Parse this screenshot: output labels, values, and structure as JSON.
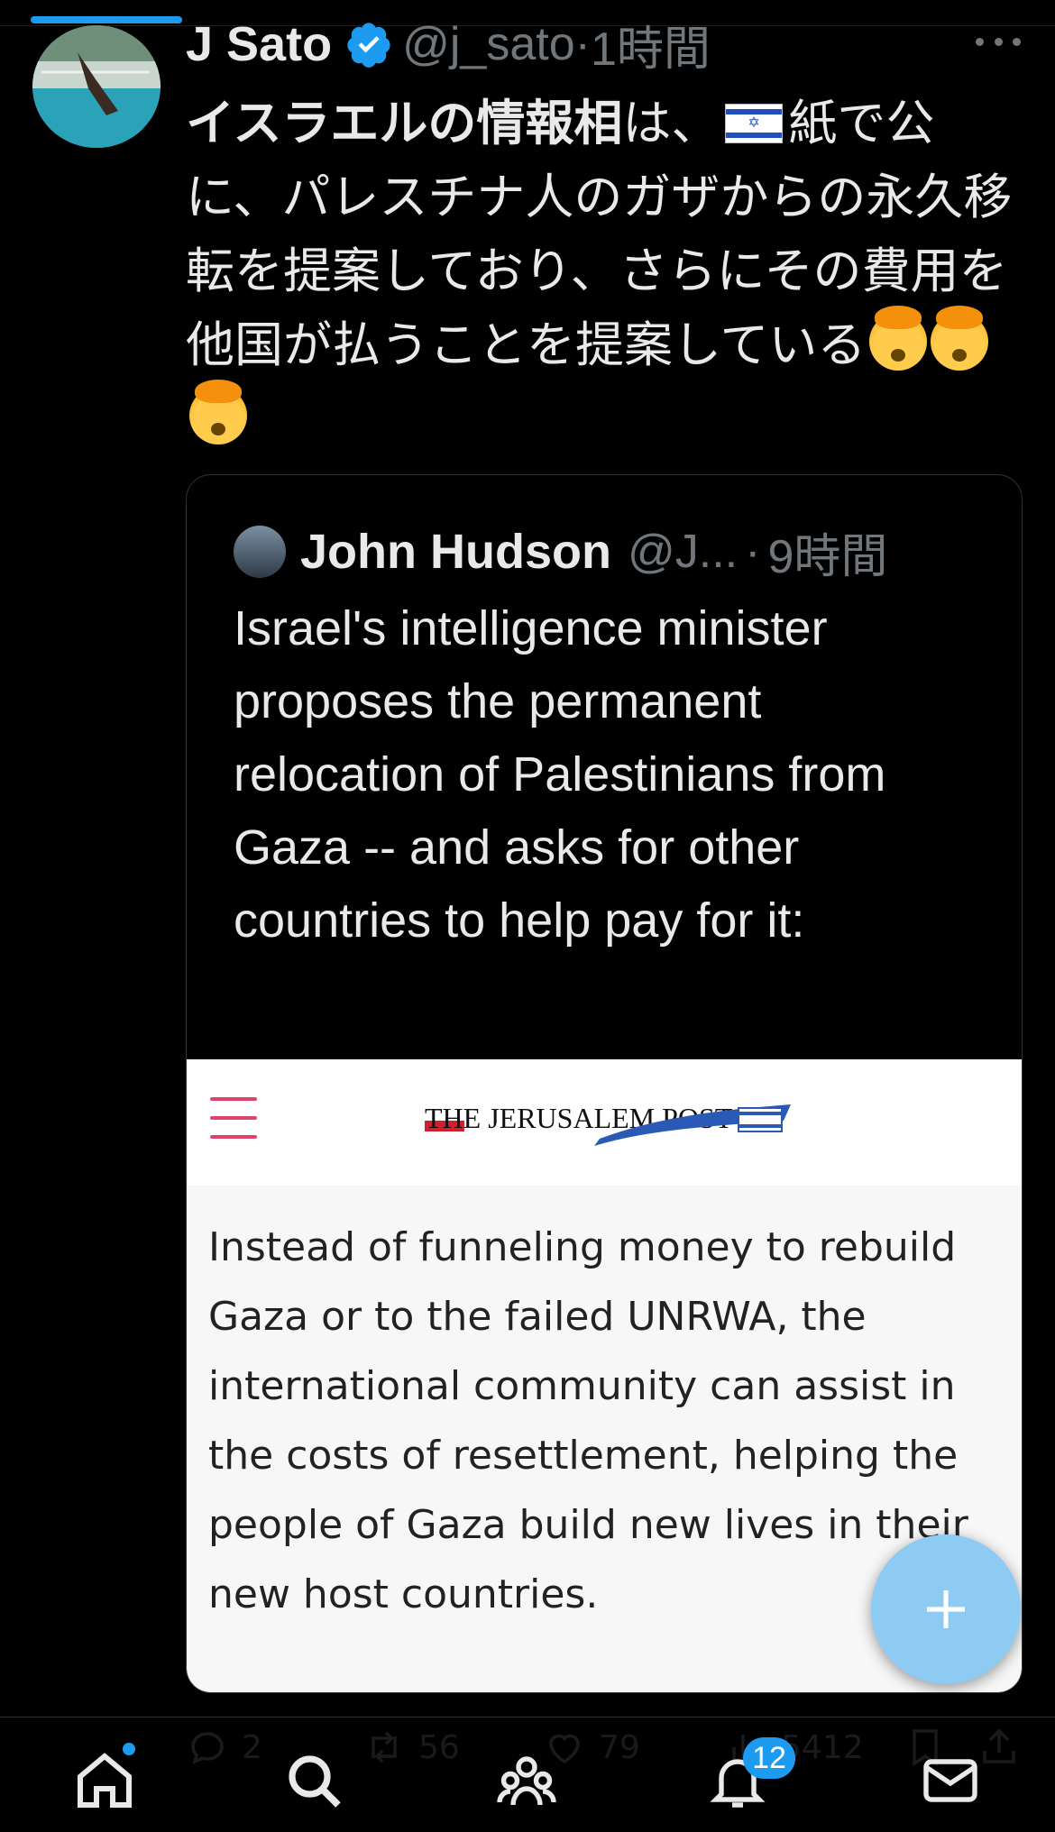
{
  "tweet": {
    "author_name": "J Sato",
    "author_handle": "@j_sato",
    "separator": "·",
    "time": "1時間",
    "text_bold": "イスラエルの情報相",
    "text_part1": "は、",
    "text_part2": "紙で公に、パレスチナ人のガザからの永久移転を提案しており、さらにその費用を他国が払うことを提案している"
  },
  "quoted": {
    "author_name": "John Hudson",
    "author_handle": "@J...",
    "separator": "·",
    "time": "9時間",
    "text": "Israel's intelligence minister proposes the permanent relocation of Palestinians from Gaza -- and asks for other countries to help pay for it:",
    "card": {
      "publication": "THE JERUSALEM POST",
      "excerpt": "Instead of funneling money to rebuild Gaza or to the failed UNRWA, the international community can assist in the costs of resettlement, helping the people of Gaza build new lives in their new host countries."
    }
  },
  "actions": {
    "replies": "2",
    "retweets": "56",
    "likes": "79",
    "views": "5412"
  },
  "tabbar": {
    "notifications_badge": "12"
  },
  "colors": {
    "accent": "#1d9bf0",
    "muted": "#71767b",
    "background": "#000000",
    "fab": "#8ecbf3"
  }
}
